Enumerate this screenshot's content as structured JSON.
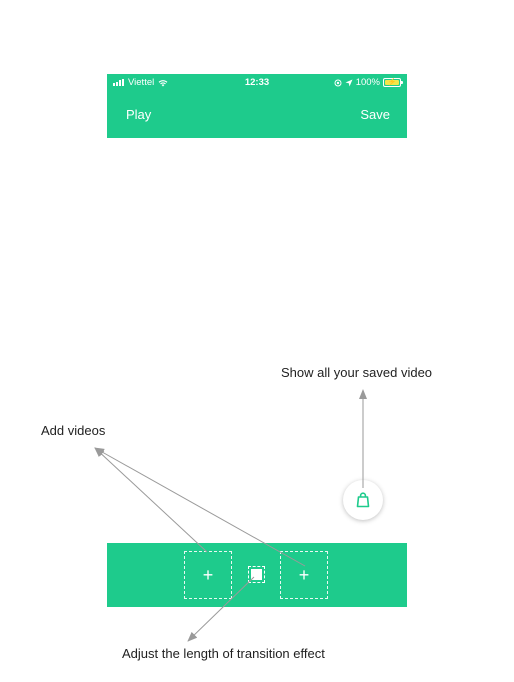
{
  "status_bar": {
    "carrier": "Viettel",
    "time": "12:33",
    "battery": "100%"
  },
  "nav": {
    "play_label": "Play",
    "save_label": "Save"
  },
  "bottom_bar": {
    "add_symbol": "+"
  },
  "annotations": {
    "saved_videos": "Show all your saved video",
    "add_videos": "Add videos",
    "transition": "Adjust the length of transition effect"
  },
  "colors": {
    "accent": "#1ecb8c",
    "arrow": "#9a9a9a"
  }
}
